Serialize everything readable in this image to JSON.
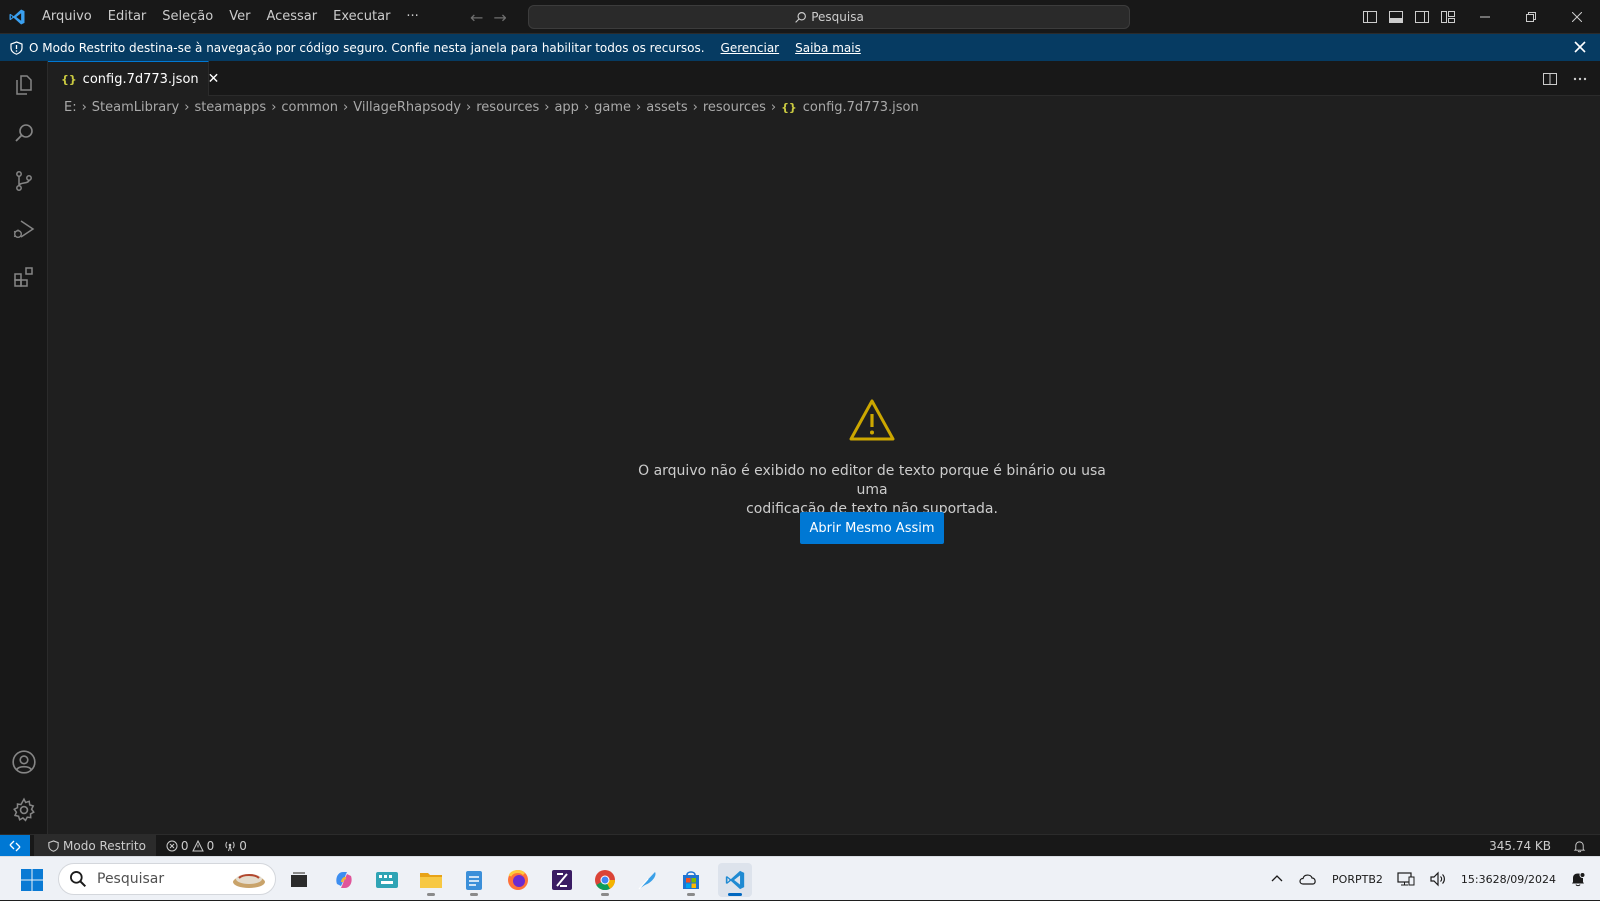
{
  "titlebar": {
    "menu": [
      "Arquivo",
      "Editar",
      "Seleção",
      "Ver",
      "Acessar",
      "Executar",
      "···"
    ],
    "search_label": "Pesquisa"
  },
  "banner": {
    "text": "O Modo Restrito destina-se à navegação por código seguro. Confie nesta janela para habilitar todos os recursos.",
    "manage_link": "Gerenciar",
    "learn_link": "Saiba mais"
  },
  "tab": {
    "icon": "{}",
    "label": "config.7d773.json"
  },
  "breadcrumb": {
    "items": [
      "E:",
      "SteamLibrary",
      "steamapps",
      "common",
      "VillageRhapsody",
      "resources",
      "app",
      "game",
      "assets",
      "resources"
    ],
    "file_icon": "{}",
    "file": "config.7d773.json"
  },
  "editor": {
    "message_line1": "O arquivo não é exibido no editor de texto porque é binário ou usa uma",
    "message_line2": "codificação de texto não suportada.",
    "open_button": "Abrir Mesmo Assim"
  },
  "statusbar": {
    "restricted_label": "Modo Restrito",
    "errors": "0",
    "warnings": "0",
    "ports": "0",
    "file_size": "345.74 KB"
  },
  "taskbar": {
    "search_placeholder": "Pesquisar",
    "lang_line1": "POR",
    "lang_line2": "PTB2",
    "time": "15:36",
    "date": "28/09/2024"
  },
  "colors": {
    "accent": "#0078d4",
    "banner": "#063b62",
    "warning": "#cca700",
    "json_icon": "#cbcb41"
  }
}
